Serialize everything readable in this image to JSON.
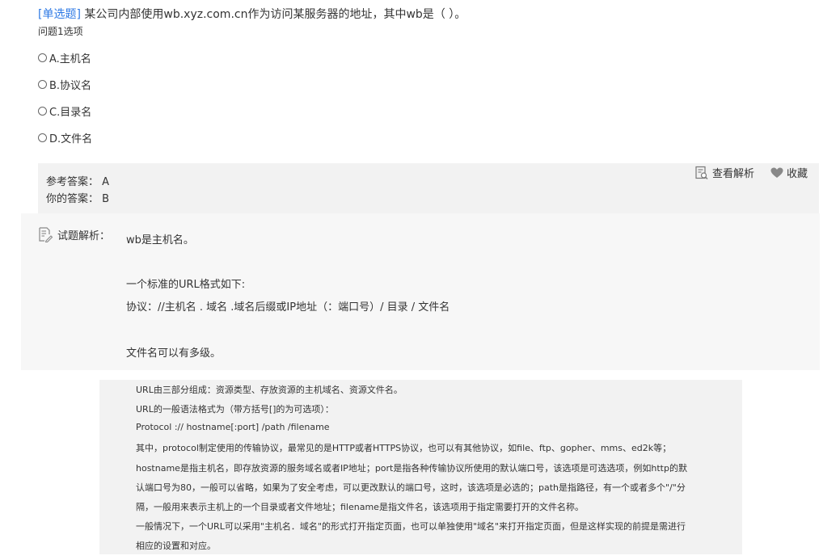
{
  "question": {
    "type_label": "[单选题]",
    "text": " 某公司内部使用wb.xyz.com.cn作为访问某服务器的地址，其中wb是（ ）。",
    "subtitle": "问题1选项"
  },
  "options": [
    {
      "label": "A.主机名"
    },
    {
      "label": "B.协议名"
    },
    {
      "label": "C.目录名"
    },
    {
      "label": "D.文件名"
    }
  ],
  "answers": {
    "reference": "参考答案：  A",
    "yours": "你的答案：  B"
  },
  "actions": {
    "view_analysis": "查看解析",
    "favorite": "收藏"
  },
  "analysis": {
    "label": "试题解析：",
    "lines": [
      "wb是主机名。",
      "一个标准的URL格式如下:",
      "协议：//主机名 . 域名 .域名后缀或IP地址（：端口号）/ 目录 / 文件名",
      "文件名可以有多级。"
    ]
  },
  "image_text": {
    "lines": [
      "URL由三部分组成：资源类型、存放资源的主机域名、资源文件名。",
      "URL的一般语法格式为（带方括号[]的为可选项）：",
      "Protocol :// hostname[:port] /path /filename",
      "其中，protocol制定使用的传输协议，最常见的是HTTP或者HTTPS协议，也可以有其他协议，如file、ftp、gopher、mms、ed2k等；",
      "hostname是指主机名，即存放资源的服务域名或者IP地址；port是指各种传输协议所使用的默认端口号，该选项是可选选项，例如http的默",
      "认端口号为80，一般可以省略，如果为了安全考虑，可以更改默认的端口号，这时，该选项是必选的；path是指路径，有一个或者多个\"/\"分",
      "隔，一般用来表示主机上的一个目录或者文件地址；filename是指文件名，该选项用于指定需要打开的文件名称。",
      "一般情况下，一个URL可以采用\"主机名．域名\"的形式打开指定页面，也可以单独使用\"域名\"来打开指定页面，但是这样实现的前提是需进行",
      "相应的设置和对应。"
    ]
  },
  "colors": {
    "question_type": "#2f7ae5",
    "answer_bg": "#f2f2f2",
    "analysis_bg": "#f7f7f7",
    "text": "#333333"
  },
  "icons": {
    "view_analysis": "document-search-icon",
    "favorite": "heart-icon",
    "analysis": "document-edit-icon"
  }
}
